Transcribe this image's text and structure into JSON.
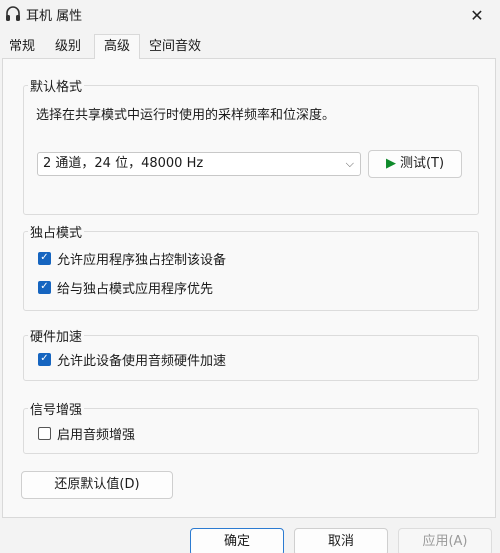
{
  "window": {
    "title": "耳机 属性",
    "close_glyph": "✕"
  },
  "tabs": [
    {
      "label": "常规",
      "active": false
    },
    {
      "label": "级别",
      "active": false
    },
    {
      "label": "高级",
      "active": true
    },
    {
      "label": "空间音效",
      "active": false
    }
  ],
  "default_format": {
    "label": "默认格式",
    "description": "选择在共享模式中运行时使用的采样频率和位深度。",
    "selected_format": "2 通道，24 位，48000 Hz",
    "test_button": "测试(T)"
  },
  "exclusive_mode": {
    "label": "独占模式",
    "options": [
      {
        "label": "允许应用程序独占控制该设备",
        "checked": true
      },
      {
        "label": "给与独占模式应用程序优先",
        "checked": true
      }
    ]
  },
  "hardware_acceleration": {
    "label": "硬件加速",
    "option": {
      "label": "允许此设备使用音频硬件加速",
      "checked": true
    }
  },
  "signal_enhancement": {
    "label": "信号增强",
    "option": {
      "label": "启用音频增强",
      "checked": false
    }
  },
  "restore_defaults_button": "还原默认值(D)",
  "footer": {
    "ok": "确定",
    "cancel": "取消",
    "apply": "应用(A)"
  },
  "colors": {
    "accent": "#1665c0",
    "play": "#0e8a2a"
  },
  "icons": {
    "title": "headphones-icon",
    "dropdown": "chevron-down-icon",
    "test": "play-icon"
  }
}
